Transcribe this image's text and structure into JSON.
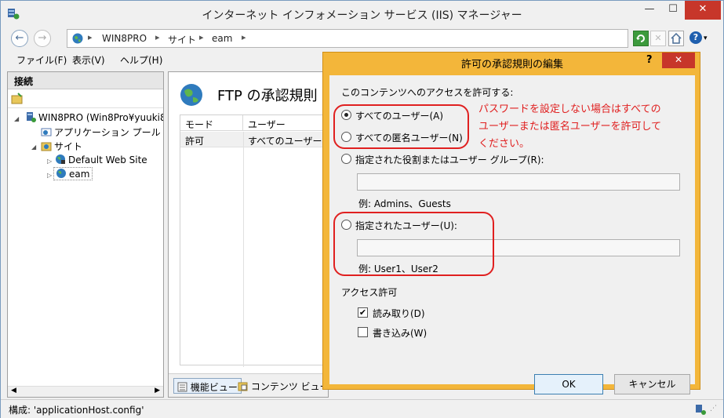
{
  "window": {
    "title": "インターネット インフォメーション サービス (IIS) マネージャー",
    "min": "—",
    "max": "☐",
    "close": "✕"
  },
  "address": {
    "crumbs": [
      "WIN8PRO",
      "サイト",
      "eam"
    ],
    "separator": "▸",
    "back": "←",
    "forward": "→",
    "help_arrow": "▾"
  },
  "menu": [
    "ファイル(F)",
    "表示(V)",
    "ヘルプ(H)"
  ],
  "connections": {
    "header": "接続",
    "tree": [
      {
        "label": "WIN8PRO (Win8Pro¥yuuki8"
      },
      {
        "label": "アプリケーション プール"
      },
      {
        "label": "サイト"
      },
      {
        "label": "Default Web Site"
      },
      {
        "label": "eam"
      }
    ]
  },
  "feature": {
    "title": "FTP の承認規則",
    "columns": [
      "モード",
      "ユーザー"
    ],
    "rows": [
      {
        "mode": "許可",
        "user": "すべてのユーザー"
      }
    ],
    "view_feature": "機能ビュー",
    "view_content": "コンテンツ ビュー"
  },
  "status": {
    "text": "構成: 'applicationHost.config'"
  },
  "dialog": {
    "title": "許可の承認規則の編集",
    "help": "?",
    "close": "✕",
    "access_label": "このコンテンツへのアクセスを許可する:",
    "options": {
      "all_users": "すべてのユーザー(A)",
      "all_anonymous": "すべての匿名ユーザー(N)",
      "roles": "指定された役割またはユーザー グループ(R):",
      "roles_example": "例: Admins、Guests",
      "users": "指定されたユーザー(U):",
      "users_example": "例: User1、User2"
    },
    "selected_option": "all_users",
    "permissions_label": "アクセス許可",
    "read": "読み取り(D)",
    "read_checked": true,
    "write": "書き込み(W)",
    "write_checked": false,
    "ok": "OK",
    "cancel": "キャンセル"
  },
  "annotation": {
    "lines": [
      "パスワードを設定しない場合はすべての",
      "ユーザーまたは匿名ユーザーを許可して",
      "ください。"
    ],
    "color": "#e02020"
  }
}
